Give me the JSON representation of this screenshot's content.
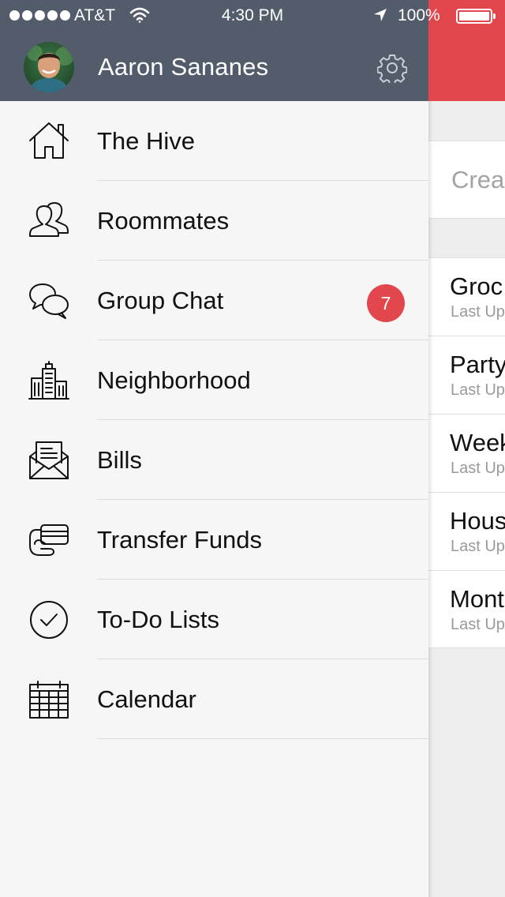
{
  "status_bar": {
    "carrier": "AT&T",
    "time": "4:30 PM",
    "battery": "100%"
  },
  "user": {
    "name": "Aaron Sananes"
  },
  "menu": {
    "items": [
      {
        "label": "The Hive",
        "icon": "home-icon"
      },
      {
        "label": "Roommates",
        "icon": "roommates-icon"
      },
      {
        "label": "Group Chat",
        "icon": "chat-bubbles-icon",
        "badge": "7"
      },
      {
        "label": "Neighborhood",
        "icon": "buildings-icon"
      },
      {
        "label": "Bills",
        "icon": "envelope-bill-icon"
      },
      {
        "label": "Transfer Funds",
        "icon": "card-hand-icon"
      },
      {
        "label": "To-Do Lists",
        "icon": "checkmark-circle-icon"
      },
      {
        "label": "Calendar",
        "icon": "calendar-icon"
      }
    ]
  },
  "content": {
    "create_placeholder": "Crea",
    "lists": [
      {
        "title": "Groc",
        "subtitle": "Last Up"
      },
      {
        "title": "Party",
        "subtitle": "Last Up"
      },
      {
        "title": "Week",
        "subtitle": "Last Up"
      },
      {
        "title": "Hous",
        "subtitle": "Last Up"
      },
      {
        "title": "Mont",
        "subtitle": "Last Up"
      }
    ]
  },
  "colors": {
    "header": "#525c6b",
    "accent": "#e2474e",
    "menu_background": "#f6f6f6"
  }
}
